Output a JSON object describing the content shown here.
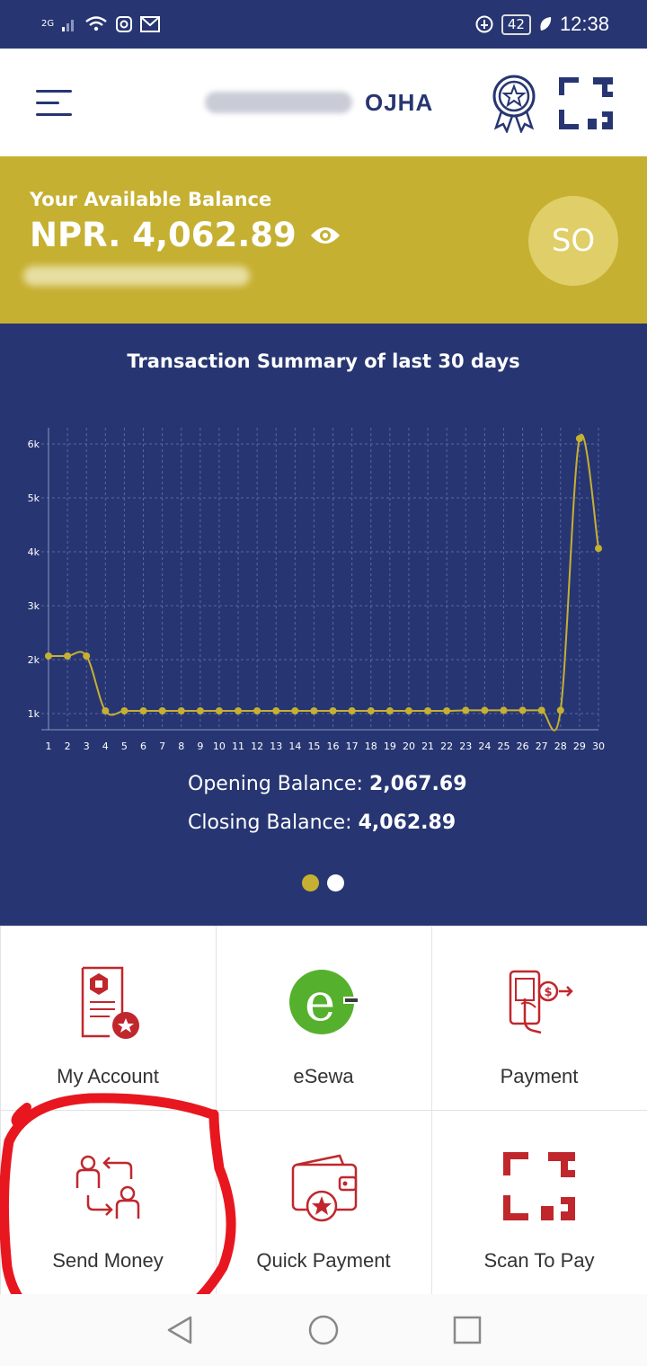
{
  "status_bar": {
    "network": "2G",
    "battery": "42",
    "time": "12:38"
  },
  "header": {
    "surname": "OJHA"
  },
  "balance": {
    "label": "Your Available Balance",
    "amount": "NPR. 4,062.89",
    "avatar_initials": "SO"
  },
  "summary": {
    "title": "Transaction Summary of last 30 days",
    "opening_label": "Opening Balance:",
    "opening_value": "2,067.69",
    "closing_label": "Closing Balance:",
    "closing_value": "4,062.89",
    "pager": {
      "count": 2,
      "active": 0,
      "active_color": "#c6b032",
      "inactive_color": "#ffffff"
    }
  },
  "chart_data": {
    "type": "line",
    "title": "",
    "xlabel": "",
    "ylabel": "",
    "x": [
      1,
      2,
      3,
      4,
      5,
      6,
      7,
      8,
      9,
      10,
      11,
      12,
      13,
      14,
      15,
      16,
      17,
      18,
      19,
      20,
      21,
      22,
      23,
      24,
      25,
      26,
      27,
      28,
      29,
      30
    ],
    "series": [
      {
        "values": [
          2067.69,
          2067.69,
          2067.69,
          1050,
          1050,
          1050,
          1050,
          1050,
          1050,
          1050,
          1050,
          1050,
          1050,
          1050,
          1050,
          1050,
          1050,
          1050,
          1050,
          1050,
          1050,
          1050,
          1060,
          1060,
          1060,
          1060,
          1060,
          1060,
          6100,
          4062.89
        ],
        "color": "#c6b032"
      }
    ],
    "ylim": [
      700,
      6300
    ],
    "y_ticks": [
      1000,
      2000,
      3000,
      4000,
      5000,
      6000
    ],
    "y_tick_labels": [
      "1k",
      "2k",
      "3k",
      "4k",
      "5k",
      "6k"
    ],
    "x_tick_labels": [
      "1",
      "2",
      "3",
      "4",
      "5",
      "6",
      "7",
      "8",
      "9",
      "10",
      "11",
      "12",
      "13",
      "14",
      "15",
      "16",
      "17",
      "18",
      "19",
      "20",
      "21",
      "22",
      "23",
      "24",
      "25",
      "26",
      "27",
      "28",
      "29",
      "30"
    ],
    "grid": true,
    "grid_style": "dashed"
  },
  "menu": [
    {
      "label": "My Account",
      "icon": "account-document-icon"
    },
    {
      "label": "eSewa",
      "icon": "esewa-logo-icon"
    },
    {
      "label": "Payment",
      "icon": "mobile-payment-icon"
    },
    {
      "label": "Send Money",
      "icon": "send-money-icon"
    },
    {
      "label": "Quick Payment",
      "icon": "wallet-star-icon"
    },
    {
      "label": "Scan To Pay",
      "icon": "qr-scan-icon"
    }
  ],
  "colors": {
    "brand_navy": "#273672",
    "brand_gold": "#c6b032",
    "icon_red": "#c0272d",
    "annotation_red": "#e8171f",
    "esewa_green": "#55b12d"
  }
}
